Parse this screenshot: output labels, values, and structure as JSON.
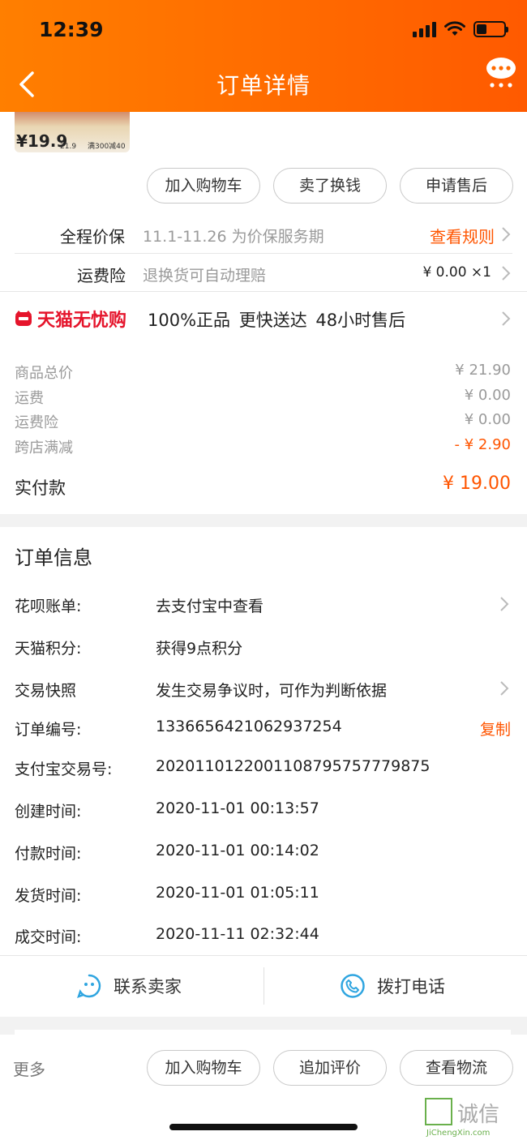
{
  "status_bar": {
    "time": "12:39"
  },
  "header": {
    "title": "订单详情",
    "back_icon": "back-chevron-icon",
    "more_icon": "chat-more-icon"
  },
  "product": {
    "price_main": "¥19.9",
    "price_second": "21.9",
    "promo": "满300减40"
  },
  "item_actions": [
    "加入购物车",
    "卖了换钱",
    "申请售后"
  ],
  "price_protect": {
    "label": "全程价保",
    "text": "11.1-11.26 为价保服务期",
    "link": "查看规则"
  },
  "shipping_insurance": {
    "label": "运费险",
    "text": "退换货可自动理赔",
    "amount": "¥ 0.00 ×1"
  },
  "tmall": {
    "brand": "天猫无忧购",
    "guarantee": "100%正品 更快送达 48小时售后"
  },
  "costs": [
    {
      "label": "商品总价",
      "value": "¥ 21.90"
    },
    {
      "label": "运费",
      "value": "¥ 0.00"
    },
    {
      "label": "运费险",
      "value": "¥ 0.00"
    },
    {
      "label": "跨店满减",
      "value": "- ¥ 2.90"
    }
  ],
  "paid": {
    "label": "实付款",
    "value": "¥ 19.00"
  },
  "order_info": {
    "title": "订单信息",
    "rows": [
      {
        "label": "花呗账单:",
        "value": "去支付宝中查看"
      },
      {
        "label": "天猫积分:",
        "value": "获得9点积分"
      },
      {
        "label": "交易快照",
        "value": "发生交易争议时，可作为判断依据"
      },
      {
        "label": "订单编号:",
        "value": "1336656421062937254"
      },
      {
        "label": "支付宝交易号:",
        "value": "2020110122001108795757779875"
      },
      {
        "label": "创建时间:",
        "value": "2020-11-01 00:13:57"
      },
      {
        "label": "付款时间:",
        "value": "2020-11-01 00:14:02"
      },
      {
        "label": "发货时间:",
        "value": "2020-11-01 01:05:11"
      },
      {
        "label": "成交时间:",
        "value": "2020-11-11 02:32:44"
      }
    ],
    "copy_label": "复制"
  },
  "contact": {
    "seller": "联系卖家",
    "phone": "拨打电话"
  },
  "bottom": {
    "more": "更多",
    "buttons": [
      "加入购物车",
      "追加评价",
      "查看物流"
    ]
  },
  "watermark": {
    "cn": "诚信",
    "en": "JiChengXin.com"
  },
  "colors": {
    "accent": "#ff5500",
    "header_start": "#ff7f00",
    "header_end": "#ff5a00",
    "tmall_red": "#e5142b",
    "icon_blue": "#2fa5e0"
  }
}
